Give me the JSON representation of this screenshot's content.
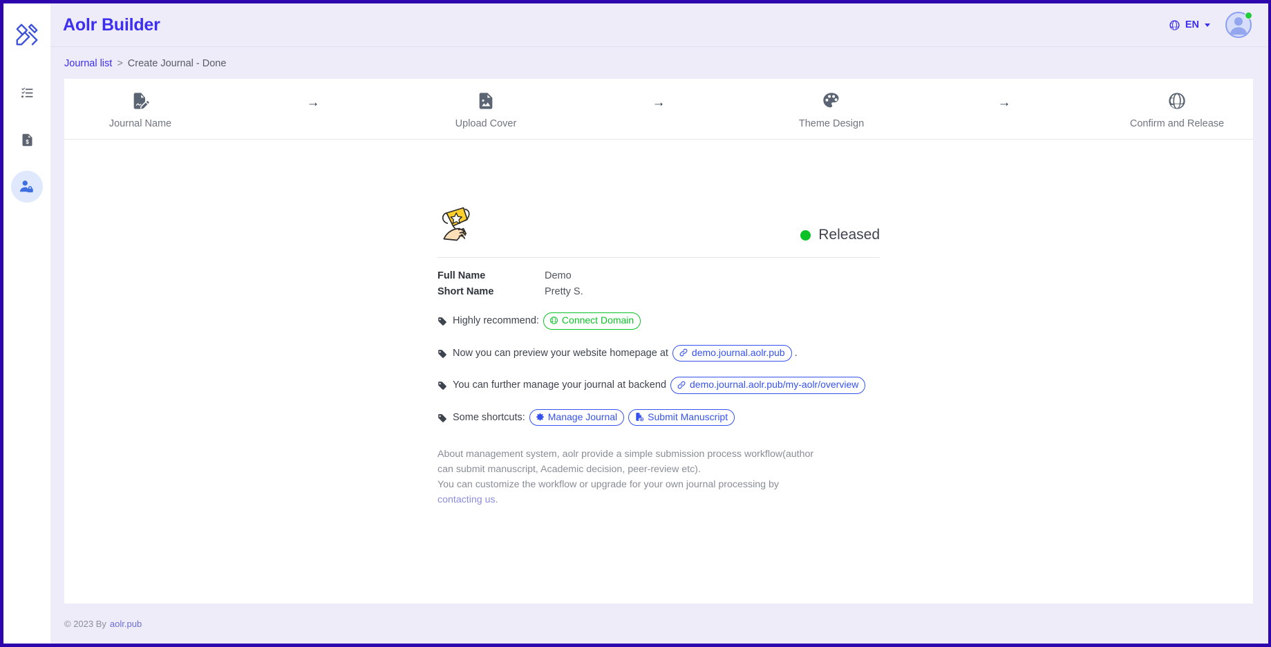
{
  "window": {
    "border_color": "#2e06ad",
    "background": "#eeecf8"
  },
  "header": {
    "title": "Aolr Builder",
    "brand_icon": "crossed-pencil-ruler-icon",
    "language": {
      "icon": "globe-icon",
      "label": "EN",
      "caret": "dropdown-caret-icon"
    },
    "account": {
      "icon": "user-avatar-icon",
      "status_color": "#21cc3d"
    }
  },
  "sidebar": {
    "items": [
      {
        "name": "sidebar-item-checklist",
        "icon": "checklist-icon",
        "active": false
      },
      {
        "name": "sidebar-item-billing",
        "icon": "invoice-dollar-icon",
        "active": false
      },
      {
        "name": "sidebar-item-account",
        "icon": "user-lock-icon",
        "active": true
      }
    ]
  },
  "breadcrumb": {
    "root": "Journal list",
    "separator": ">",
    "current": "Create Journal - Done"
  },
  "stepper": {
    "arrow": "→",
    "steps": [
      {
        "label": "Journal Name",
        "icon": "file-pen-icon"
      },
      {
        "label": "Upload Cover",
        "icon": "file-image-icon"
      },
      {
        "label": "Theme Design",
        "icon": "palette-icon"
      },
      {
        "label": "Confirm and Release",
        "icon": "globe-icon"
      }
    ]
  },
  "main": {
    "trophy_icon": "trophy-in-hand-icon",
    "status": {
      "label": "Released",
      "color": "#0ac225"
    },
    "details": [
      {
        "key": "Full Name",
        "value": "Demo"
      },
      {
        "key": "Short Name",
        "value": "Pretty S."
      }
    ],
    "rows": {
      "recommend": {
        "text": "Highly recommend:",
        "pill_label": "Connect Domain",
        "pill_icon": "globe-icon",
        "pill_color": "#0ac225"
      },
      "preview": {
        "text": "Now you can preview your website homepage at",
        "pill_label": "demo.journal.aolr.pub",
        "pill_icon": "link-icon",
        "pill_color": "#3552ee",
        "trailing": "."
      },
      "backend": {
        "text": "You can further manage your journal at backend",
        "pill_label": "demo.journal.aolr.pub/my-aolr/overview",
        "pill_icon": "link-icon",
        "pill_color": "#3552ee"
      },
      "shortcuts": {
        "text": "Some shortcuts:",
        "pills": [
          {
            "label": "Manage Journal",
            "icon": "gear-icon",
            "color": "#3552ee"
          },
          {
            "label": "Submit Manuscript",
            "icon": "file-upload-icon",
            "color": "#3552ee"
          }
        ]
      }
    },
    "about": {
      "line1": "About management system, aolr provide a simple submission process workflow(author can submit manuscript, Academic decision, peer-review etc).",
      "line2_prefix": "You can customize the workflow or upgrade for your own journal processing by ",
      "line2_link": "contacting us",
      "line2_suffix": "."
    }
  },
  "footer": {
    "copyright": "© 2023 By",
    "link": "aolr.pub"
  }
}
